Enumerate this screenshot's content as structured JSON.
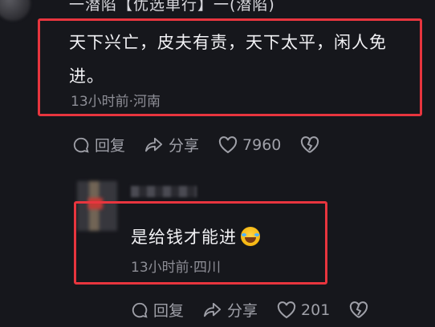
{
  "header": {
    "partial_title": "一潜陷【优选单行】一(潜陷)"
  },
  "comment1": {
    "text": "天下兴亡，皮夫有责，天下太平，闲人免进。",
    "meta": "13小时前·河南",
    "actions": {
      "reply_label": "回复",
      "share_label": "分享",
      "like_count": "7960"
    }
  },
  "comment2": {
    "text": "是给钱才能进",
    "emoji_icon": "crying-laughing-emoji",
    "meta": "13小时前·四川",
    "actions": {
      "reply_label": "回复",
      "share_label": "分享",
      "like_count": "201"
    }
  },
  "colors": {
    "background": "#16171c",
    "highlight_frame": "#e8353e",
    "meta_text": "#8d8e96"
  }
}
